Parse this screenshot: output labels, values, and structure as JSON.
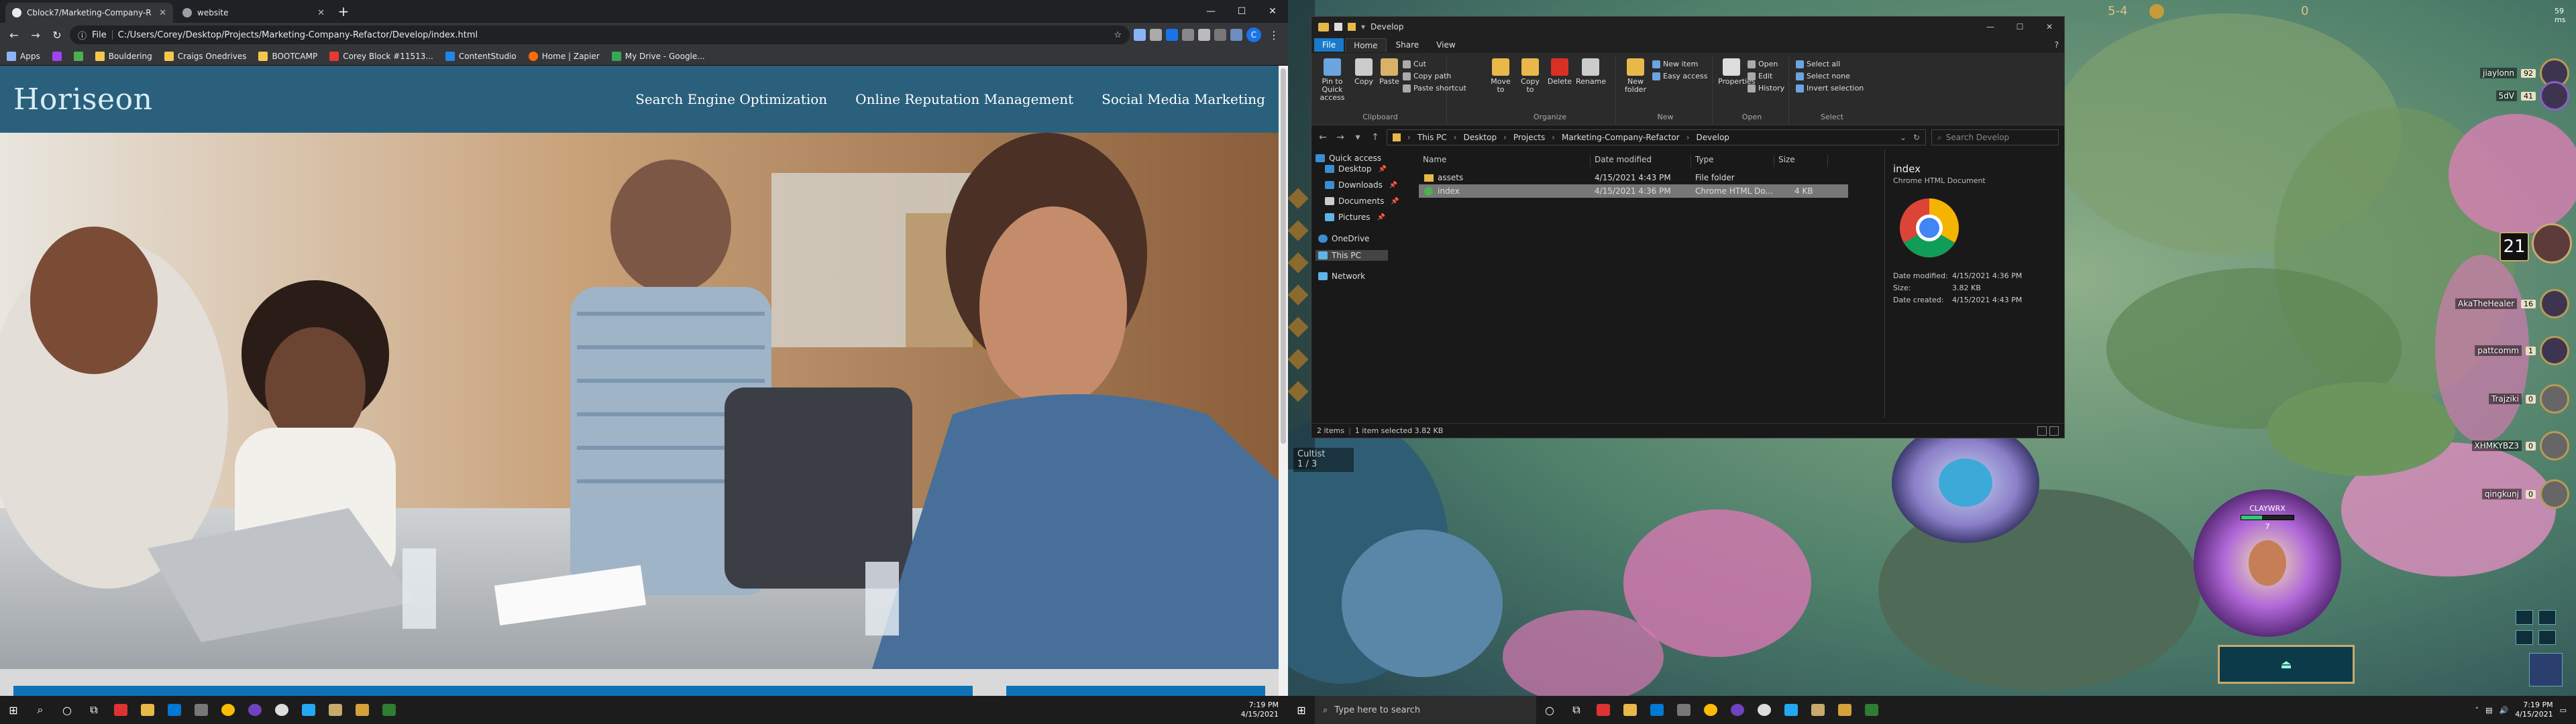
{
  "chrome": {
    "tabs": [
      {
        "label": "Cblock7/Marketing-Company-R",
        "active": true
      },
      {
        "label": "website",
        "active": false
      }
    ],
    "new_tab_icon": "plus-icon",
    "address": {
      "scheme_label": "File",
      "url": "C:/Users/Corey/Desktop/Projects/Marketing-Company-Refactor/Develop/index.html"
    },
    "profile_initial": "C",
    "bookmarks": [
      "Apps",
      "Bouldering",
      "Craigs Onedrives",
      "BOOTCAMP",
      "Corey Block #11513...",
      "ContentStudio",
      "Home | Zapier",
      "My Drive - Google..."
    ]
  },
  "site": {
    "logo": "Horiseon",
    "nav": [
      "Search Engine Optimization",
      "Online Reputation Management",
      "Social Media Marketing"
    ]
  },
  "taskbar_left": {
    "time": "7:19 PM",
    "date": "4/15/2021"
  },
  "explorer": {
    "title": "Develop",
    "menu_tabs": [
      "File",
      "Home",
      "Share",
      "View"
    ],
    "ribbon": {
      "clipboard": {
        "pin": "Pin to Quick access",
        "copy": "Copy",
        "paste": "Paste",
        "cut": "Cut",
        "copy_path": "Copy path",
        "paste_shortcut": "Paste shortcut",
        "group": "Clipboard"
      },
      "organize": {
        "move_to": "Move to",
        "copy_to": "Copy to",
        "delete": "Delete",
        "rename": "Rename",
        "group": "Organize"
      },
      "new": {
        "new_folder": "New folder",
        "new_item": "New item",
        "easy_access": "Easy access",
        "group": "New"
      },
      "open": {
        "properties": "Properties",
        "open": "Open",
        "edit": "Edit",
        "history": "History",
        "group": "Open"
      },
      "select": {
        "select_all": "Select all",
        "select_none": "Select none",
        "invert": "Invert selection",
        "group": "Select"
      }
    },
    "breadcrumb": [
      "This PC",
      "Desktop",
      "Projects",
      "Marketing-Company-Refactor",
      "Develop"
    ],
    "search_placeholder": "Search Develop",
    "nav": {
      "quick_access": "Quick access",
      "items": [
        "Desktop",
        "Downloads",
        "Documents",
        "Pictures"
      ],
      "onedrive": "OneDrive",
      "this_pc": "This PC",
      "network": "Network"
    },
    "columns": [
      "Name",
      "Date modified",
      "Type",
      "Size"
    ],
    "files": [
      {
        "name": "assets",
        "date": "4/15/2021 4:43 PM",
        "type": "File folder",
        "size": ""
      },
      {
        "name": "index",
        "date": "4/15/2021 4:36 PM",
        "type": "Chrome HTML Do...",
        "size": "4 KB"
      }
    ],
    "preview": {
      "name": "index",
      "type": "Chrome HTML Document",
      "modified_label": "Date modified:",
      "modified": "4/15/2021 4:36 PM",
      "size_label": "Size:",
      "size": "3.82 KB",
      "created_label": "Date created:",
      "created": "4/15/2021 4:43 PM"
    },
    "status": {
      "items": "2 items",
      "selected": "1 item selected  3.82 KB"
    }
  },
  "game": {
    "round": "5-4",
    "gold": "0",
    "top_right": "59 ms",
    "players": [
      {
        "name": "jiaylonn",
        "hp": "92"
      },
      {
        "name": "5dV",
        "hp": "41"
      },
      {
        "name": "AkaTheHealer",
        "hp": "16"
      },
      {
        "name": "pattcomm",
        "hp": "1"
      },
      {
        "name": "Trajziki",
        "hp": "0"
      },
      {
        "name": "XHMKYBZ3",
        "hp": "0"
      },
      {
        "name": "qingkunj",
        "hp": "0"
      }
    ],
    "level": "21",
    "trait": {
      "name": "Cultist",
      "count": "1 / 3"
    },
    "unit_name": "CLAYWRX",
    "unit_level": "7"
  },
  "taskbar_right": {
    "search_placeholder": "Type here to search",
    "time": "7:19 PM",
    "date": "4/15/2021"
  },
  "colors": {
    "site_header": "#2a607c",
    "chrome_dark": "#202124",
    "explorer_bg": "#191919",
    "accent_blue": "#1979ca"
  }
}
